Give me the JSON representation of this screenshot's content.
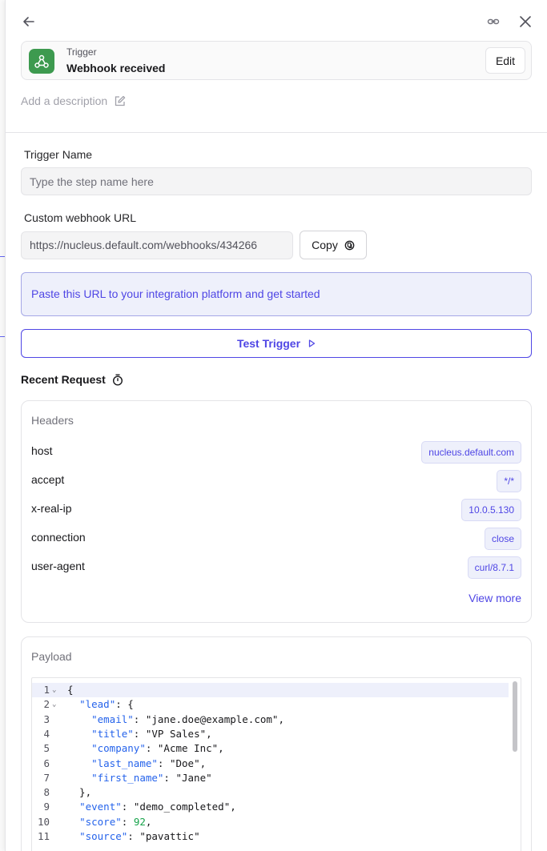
{
  "trigger": {
    "kind": "Trigger",
    "title": "Webhook received",
    "edit_label": "Edit",
    "icon": "webhook-icon",
    "icon_color": "#3d9a4f"
  },
  "description_placeholder": "Add a description",
  "trigger_name": {
    "label": "Trigger Name",
    "placeholder": "Type the step name here",
    "value": ""
  },
  "webhook": {
    "label": "Custom webhook URL",
    "url": "https://nucleus.default.com/webhooks/434266",
    "copy_label": "Copy",
    "info": "Paste this URL to your integration platform and get started"
  },
  "test_button": "Test Trigger",
  "recent_request": {
    "title": "Recent Request",
    "headers_title": "Headers",
    "headers": [
      {
        "key": "host",
        "value": "nucleus.default.com"
      },
      {
        "key": "accept",
        "value": "*/*"
      },
      {
        "key": "x-real-ip",
        "value": "10.0.5.130"
      },
      {
        "key": "connection",
        "value": "close"
      },
      {
        "key": "user-agent",
        "value": "curl/8.7.1"
      }
    ],
    "view_more": "View more",
    "payload_title": "Payload",
    "payload_lines": [
      {
        "n": "1",
        "text": "{"
      },
      {
        "n": "2",
        "text": "  \"lead\": {"
      },
      {
        "n": "3",
        "text": "    \"email\": \"jane.doe@example.com\","
      },
      {
        "n": "4",
        "text": "    \"title\": \"VP Sales\","
      },
      {
        "n": "5",
        "text": "    \"company\": \"Acme Inc\","
      },
      {
        "n": "6",
        "text": "    \"last_name\": \"Doe\","
      },
      {
        "n": "7",
        "text": "    \"first_name\": \"Jane\""
      },
      {
        "n": "8",
        "text": "  },"
      },
      {
        "n": "9",
        "text": "  \"event\": \"demo_completed\","
      },
      {
        "n": "10",
        "text": "  \"score\": 92,"
      },
      {
        "n": "11",
        "text": "  \"source\": \"pavattic\""
      }
    ]
  },
  "colors": {
    "accent": "#4f46e5",
    "accent_bg": "#eef0fb",
    "border": "#e4e4e7"
  }
}
